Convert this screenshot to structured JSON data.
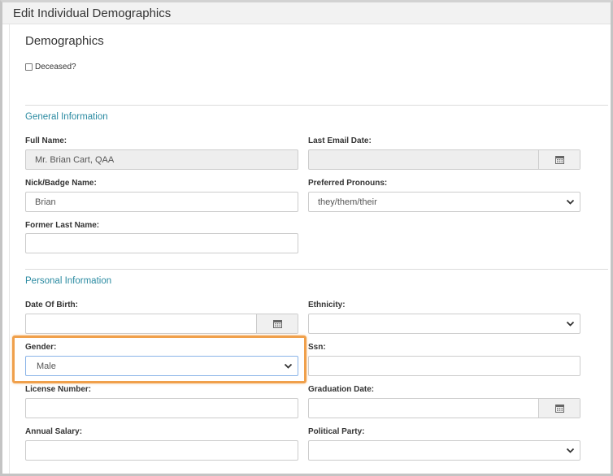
{
  "dialog": {
    "title": "Edit Individual Demographics"
  },
  "section": {
    "heading": "Demographics"
  },
  "deceased": {
    "label": "Deceased?",
    "checked": false
  },
  "general": {
    "title": "General Information",
    "full_name": {
      "label": "Full Name:",
      "value": "Mr. Brian Cart, QAA"
    },
    "last_email_date": {
      "label": "Last Email Date:",
      "value": ""
    },
    "nick_badge_name": {
      "label": "Nick/Badge Name:",
      "value": "Brian"
    },
    "preferred_pronouns": {
      "label": "Preferred Pronouns:",
      "value": "they/them/their"
    },
    "former_last_name": {
      "label": "Former Last Name:",
      "value": ""
    }
  },
  "personal": {
    "title": "Personal Information",
    "date_of_birth": {
      "label": "Date Of Birth:",
      "value": ""
    },
    "ethnicity": {
      "label": "Ethnicity:",
      "value": ""
    },
    "gender": {
      "label": "Gender:",
      "value": "Male"
    },
    "ssn": {
      "label": "Ssn:",
      "value": ""
    },
    "license_number": {
      "label": "License Number:",
      "value": ""
    },
    "graduation_date": {
      "label": "Graduation Date:",
      "value": ""
    },
    "annual_salary": {
      "label": "Annual Salary:",
      "value": ""
    },
    "political_party": {
      "label": "Political Party:",
      "value": ""
    }
  },
  "icons": {
    "calendar": "calendar-icon",
    "dropdown": "chevron-down-icon"
  },
  "colors": {
    "section_title": "#2a8aa1",
    "highlight": "#f0a04b",
    "disabled_bg": "#eeeeee"
  }
}
